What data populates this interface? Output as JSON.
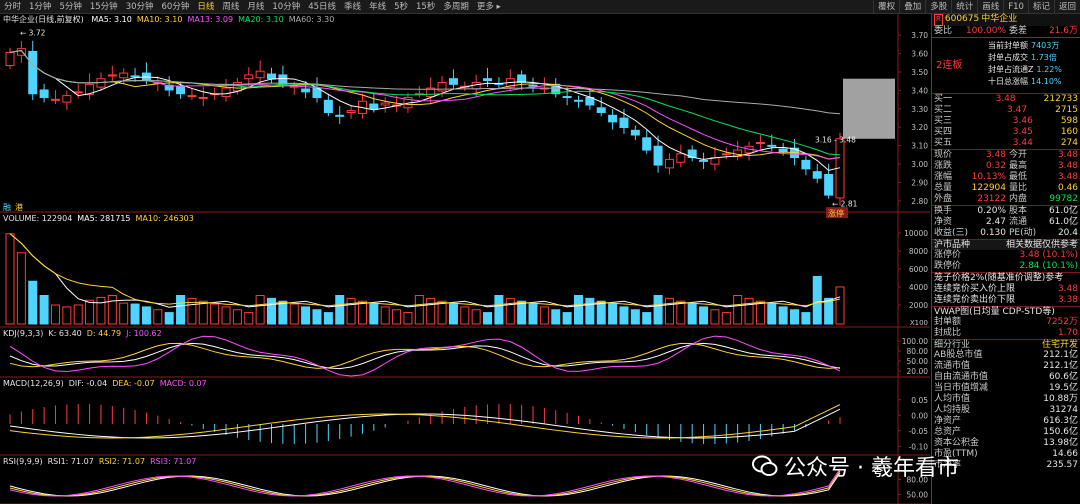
{
  "toolbar": {
    "periods": [
      "分时",
      "1分钟",
      "5分钟",
      "15分钟",
      "30分钟",
      "60分钟",
      "日线",
      "周线",
      "月线",
      "10分钟",
      "45日线",
      "季线",
      "年线",
      "5秒",
      "15秒",
      "多周期",
      "更多 ▸"
    ],
    "active_period": "日线",
    "right_buttons": [
      "覆权",
      "叠加",
      "多股",
      "统计",
      "画线",
      "F10",
      "标记",
      "返回"
    ]
  },
  "kline_pane": {
    "name": "中华企业(日线,前复权)",
    "ma": [
      {
        "label": "MA5: 3.10",
        "color": "#ffffff"
      },
      {
        "label": "MA10: 3.10",
        "color": "#ffd232"
      },
      {
        "label": "MA13: 3.09",
        "color": "#ff4fff"
      },
      {
        "label": "MA20: 3.10",
        "color": "#00e35c"
      },
      {
        "label": "MA60: 3.30",
        "color": "#aaaaaa"
      }
    ],
    "y_ticks": [
      "3.70",
      "3.60",
      "3.50",
      "3.40",
      "3.30",
      "3.20",
      "3.10",
      "3.00",
      "2.90",
      "2.80"
    ],
    "high_label": "3.72",
    "low_label": "2.81",
    "range_label": "3.16 - 3.48",
    "limit_badge": "涨停",
    "bottom_tags": [
      "融",
      "港"
    ]
  },
  "volume_pane": {
    "labels": [
      {
        "text": "VOLUME: 122904",
        "color": "#e6e6e6"
      },
      {
        "text": "MA5: 281715",
        "color": "#ffffff"
      },
      {
        "text": "MA10: 246303",
        "color": "#ffd232"
      }
    ],
    "y_ticks": [
      "10000",
      "8000",
      "6000",
      "4000",
      "2000"
    ],
    "unit": "X100"
  },
  "kdj_pane": {
    "labels": [
      {
        "text": "KDJ(9,3,3)",
        "color": "#e6e6e6"
      },
      {
        "text": "K: 63.40",
        "color": "#e6e6e6"
      },
      {
        "text": "D: 44.79",
        "color": "#ffd232"
      },
      {
        "text": "J: 100.62",
        "color": "#ff4fff"
      }
    ],
    "y_ticks": [
      "100.00",
      "80.00",
      "50.00",
      "20.00"
    ]
  },
  "macd_pane": {
    "labels": [
      {
        "text": "MACD(12,26,9)",
        "color": "#e6e6e6"
      },
      {
        "text": "DIF: -0.04",
        "color": "#e6e6e6"
      },
      {
        "text": "DEA: -0.07",
        "color": "#ffd232"
      },
      {
        "text": "MACD: 0.07",
        "color": "#ff4fff"
      }
    ],
    "y_ticks": [
      "0.05",
      "0.00",
      "-0.05",
      "-0.10"
    ]
  },
  "rsi_pane": {
    "labels": [
      {
        "text": "RSI(9,9,9)",
        "color": "#e6e6e6"
      },
      {
        "text": "RSI1: 71.07",
        "color": "#e6e6e6"
      },
      {
        "text": "RSI2: 71.07",
        "color": "#ffd232"
      },
      {
        "text": "RSI3: 71.07",
        "color": "#ff4fff"
      }
    ],
    "y_ticks": [
      "80.00",
      "50.00"
    ]
  },
  "panel": {
    "code": "600675",
    "name": "中华企业",
    "top_badge": "R",
    "wei": {
      "label1": "委比",
      "val1": "100.00%",
      "label2": "委差",
      "val2": "21.6万"
    },
    "lianban": "2连板",
    "lianban_info": [
      {
        "label": "当前封单额",
        "value": "7403万"
      },
      {
        "label": "封单占成交",
        "value": "1.73倍"
      },
      {
        "label": "封单占流通Z",
        "value": "1.22%"
      },
      {
        "label": "十日总涨幅",
        "value": "14.10%"
      }
    ],
    "buys": [
      {
        "label": "买一",
        "price": "3.48",
        "vol": "212733"
      },
      {
        "label": "买二",
        "price": "3.47",
        "vol": "2715"
      },
      {
        "label": "买三",
        "price": "3.46",
        "vol": "598"
      },
      {
        "label": "买四",
        "price": "3.45",
        "vol": "160"
      },
      {
        "label": "买五",
        "price": "3.44",
        "vol": "274"
      }
    ],
    "quote": [
      {
        "l1": "现价",
        "v1": "3.48",
        "c1": "red",
        "l2": "今开",
        "v2": "3.48",
        "c2": "red"
      },
      {
        "l1": "涨跌",
        "v1": "0.32",
        "c1": "red",
        "l2": "最高",
        "v2": "3.48",
        "c2": "red"
      },
      {
        "l1": "涨幅",
        "v1": "10.13%",
        "c1": "red",
        "l2": "最低",
        "v2": "3.48",
        "c2": "red"
      },
      {
        "l1": "总量",
        "v1": "122904",
        "c1": "yellow",
        "l2": "量比",
        "v2": "0.46",
        "c2": "yellow"
      },
      {
        "l1": "外盘",
        "v1": "23122",
        "c1": "red",
        "l2": "内盘",
        "v2": "99782",
        "c2": "green"
      }
    ],
    "fund": [
      {
        "l1": "换手",
        "v1": "0.20%",
        "l2": "股本",
        "v2": "61.0亿"
      },
      {
        "l1": "净资",
        "v1": "2.47",
        "l2": "流通",
        "v2": "61.0亿"
      },
      {
        "l1": "收益(三)",
        "v1": "0.130",
        "l2": "PE(动)",
        "v2": "20.4"
      }
    ],
    "market": {
      "left": "沪市品种",
      "right": "相关数据仅供参考"
    },
    "limit_up": {
      "label": "涨停价",
      "value": "3.48 (10.1%)"
    },
    "limit_down": {
      "label": "跌停价",
      "value": "2.84 (10.1%)"
    },
    "cage_lines": [
      {
        "text": "笼子价格2%(随基准价调整)参考",
        "value": ""
      },
      {
        "text": "连续竞价买入价上限",
        "value": "3.48"
      },
      {
        "text": "连续竞价卖出价下限",
        "value": "3.38"
      }
    ],
    "vwap": "VWAP图(日均量 CDP-STD等)",
    "fengdan": [
      {
        "label": "封单额",
        "value": "7252万"
      },
      {
        "label": "封成比",
        "value": "1.70"
      }
    ],
    "industry": {
      "label": "细分行业",
      "value": "住宅开发"
    },
    "stats": [
      {
        "label": "AB股总市值",
        "value": "212.1亿"
      },
      {
        "label": "流通市值",
        "value": "212.1亿"
      },
      {
        "label": "自由流通市值",
        "value": "60.6亿"
      },
      {
        "label": "当日市值增减",
        "value": "19.5亿"
      },
      {
        "label": "人均市值",
        "value": "10.88万"
      },
      {
        "label": "人均持股",
        "value": "31274"
      },
      {
        "label": "净资产",
        "value": "616.3亿"
      },
      {
        "label": "总资产",
        "value": "150.6亿"
      },
      {
        "label": "资本公积金",
        "value": "13.98亿"
      },
      {
        "label": "市盈(TTM)",
        "value": "14.66"
      },
      {
        "label": "市净率",
        "value": "235.57"
      }
    ]
  },
  "watermark": "公众号 · 羲年看市"
}
